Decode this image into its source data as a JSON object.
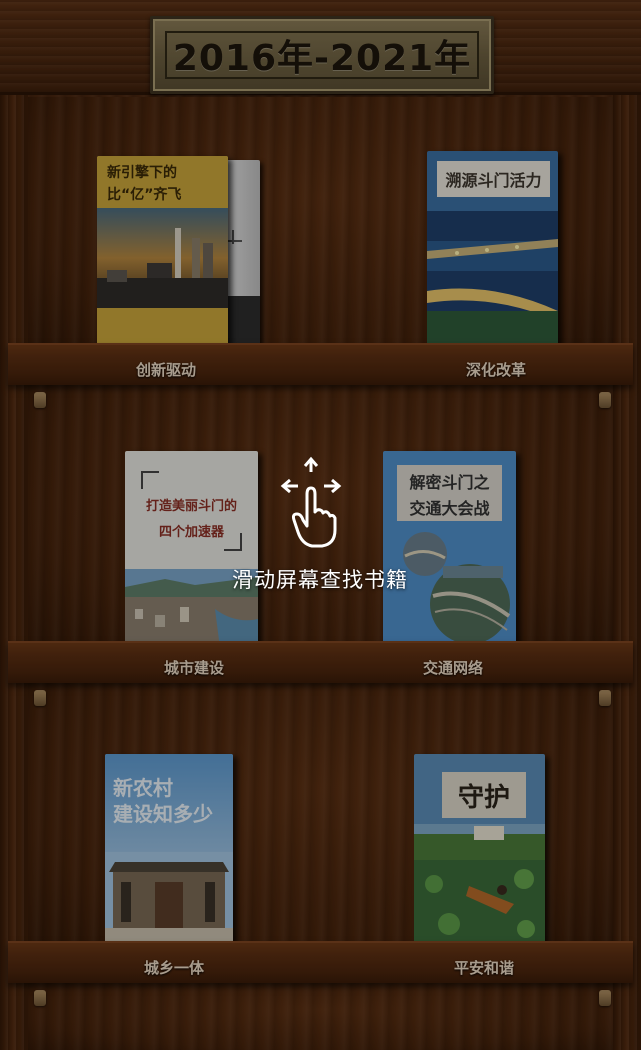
{
  "header": {
    "title": "2016年-2021年"
  },
  "shelves": [
    {
      "books": [
        {
          "label": "创新驱动",
          "cover_title_line1": "新引擎下的",
          "cover_title_line2": "比“亿”齐飞",
          "cover_color": "#c7a53a"
        },
        {
          "label": "深化改革",
          "cover_title": "溯源斗门活力",
          "cover_color": "#3b6fa3"
        }
      ]
    },
    {
      "books": [
        {
          "label": "城市建设",
          "cover_title_line1": "打造美丽斗门的",
          "cover_title_line2": "四个加速器",
          "cover_color": "#e7e6e1"
        },
        {
          "label": "交通网络",
          "cover_title_line1": "解密斗门之",
          "cover_title_line2": "交通大会战",
          "cover_color": "#4f8fc9"
        }
      ]
    },
    {
      "books": [
        {
          "label": "城乡一体",
          "cover_title_line1": "新农村",
          "cover_title_line2": "建设知多少",
          "cover_color": "#6fa4d0"
        },
        {
          "label": "平安和谐",
          "cover_title": "守护",
          "cover_color": "#5b8db8"
        }
      ]
    }
  ],
  "hint": {
    "text": "滑动屏幕查找书籍",
    "icon": "swipe-hand-icon"
  }
}
